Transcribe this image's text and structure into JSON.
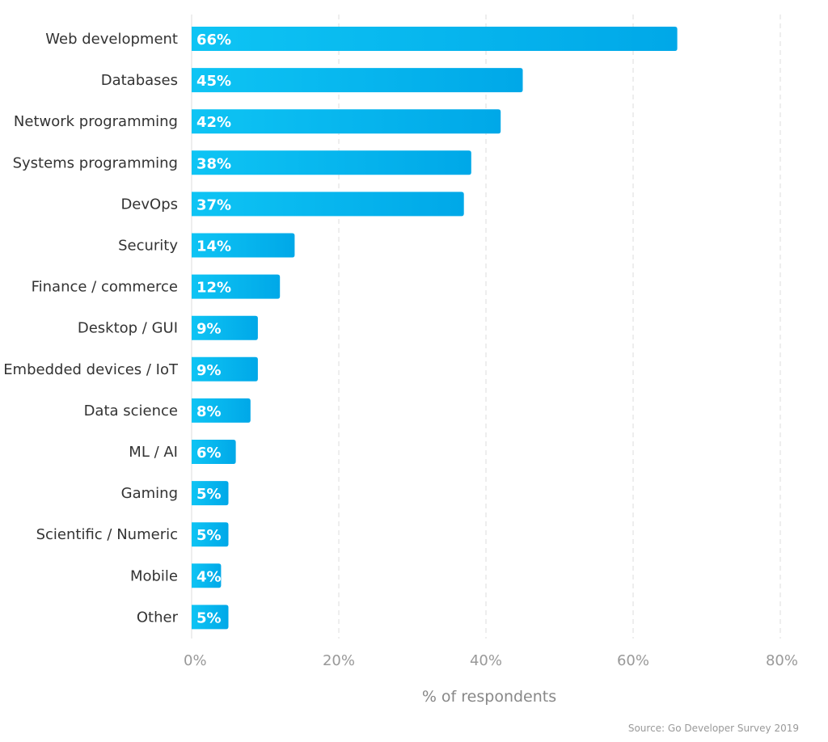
{
  "chart_data": {
    "type": "bar",
    "orientation": "horizontal",
    "categories": [
      "Web development",
      "Databases",
      "Network programming",
      "Systems programming",
      "DevOps",
      "Security",
      "Finance / commerce",
      "Desktop / GUI",
      "Embedded devices / IoT",
      "Data science",
      "ML / AI",
      "Gaming",
      "Scientific / Numeric",
      "Mobile",
      "Other"
    ],
    "values": [
      66,
      45,
      42,
      38,
      37,
      14,
      12,
      9,
      9,
      8,
      6,
      5,
      5,
      4,
      5
    ],
    "value_labels": [
      "66%",
      "45%",
      "42%",
      "38%",
      "37%",
      "14%",
      "12%",
      "9%",
      "9%",
      "8%",
      "6%",
      "5%",
      "5%",
      "4%",
      "5%"
    ],
    "xlabel": "% of respondents",
    "ylabel": "",
    "xlim": [
      0,
      80
    ],
    "xticks": [
      0,
      20,
      40,
      60,
      80
    ],
    "xtick_labels": [
      "0%",
      "20%",
      "40%",
      "60%",
      "80%"
    ],
    "grid": true,
    "source": "Source: Go Developer Survey 2019",
    "colors": {
      "bar_start": "#0ec4f4",
      "bar_end": "#00a8e8",
      "grid": "#e2e2e2"
    }
  }
}
